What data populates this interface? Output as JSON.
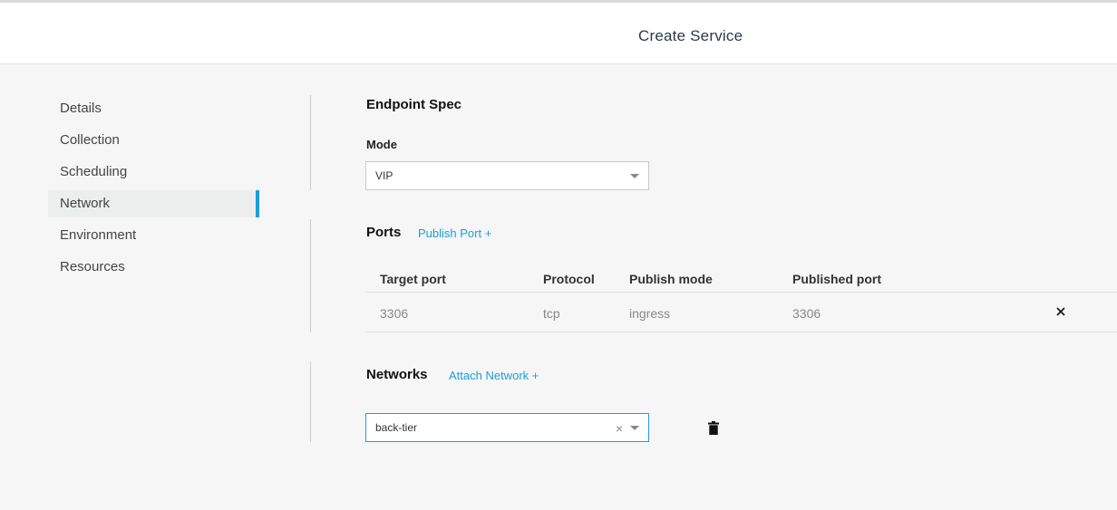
{
  "header": {
    "title": "Create Service"
  },
  "nav": {
    "items": [
      {
        "label": "Details"
      },
      {
        "label": "Collection"
      },
      {
        "label": "Scheduling"
      },
      {
        "label": "Network"
      },
      {
        "label": "Environment"
      },
      {
        "label": "Resources"
      }
    ],
    "active": "Network"
  },
  "endpoint": {
    "title": "Endpoint Spec",
    "mode_label": "Mode",
    "mode_value": "VIP"
  },
  "ports": {
    "title": "Ports",
    "publish_link": "Publish Port +",
    "columns": [
      "Target port",
      "Protocol",
      "Publish mode",
      "Published port"
    ],
    "rows": [
      {
        "target": "3306",
        "protocol": "tcp",
        "mode": "ingress",
        "published": "3306"
      }
    ]
  },
  "networks": {
    "title": "Networks",
    "attach_link": "Attach Network +",
    "selected": "back-tier",
    "clear_icon": "×"
  },
  "colors": {
    "accent": "#1b9fdb",
    "background": "#f6f6f6",
    "header_bg": "#ffffff"
  }
}
